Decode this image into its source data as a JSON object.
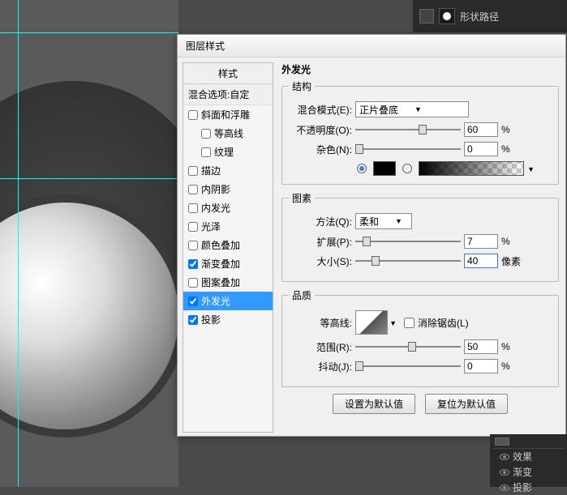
{
  "toolbar": {
    "shape_path_label": "形状路径"
  },
  "dialog": {
    "title": "图层样式",
    "styles_header": "样式",
    "blend_options": "混合选项:自定",
    "items": [
      {
        "label": "斜面和浮雕",
        "checked": false
      },
      {
        "label": "等高线",
        "checked": false,
        "indent": true
      },
      {
        "label": "纹理",
        "checked": false,
        "indent": true
      },
      {
        "label": "描边",
        "checked": false
      },
      {
        "label": "内阴影",
        "checked": false
      },
      {
        "label": "内发光",
        "checked": false
      },
      {
        "label": "光泽",
        "checked": false
      },
      {
        "label": "颜色叠加",
        "checked": false
      },
      {
        "label": "渐变叠加",
        "checked": true
      },
      {
        "label": "图案叠加",
        "checked": false
      },
      {
        "label": "外发光",
        "checked": true,
        "selected": true
      },
      {
        "label": "投影",
        "checked": true
      }
    ],
    "panel_title": "外发光",
    "structure": {
      "legend": "结构",
      "blend_mode_label": "混合模式(E):",
      "blend_mode_value": "正片叠底",
      "opacity_label": "不透明度(O):",
      "opacity_value": "60",
      "opacity_unit": "%",
      "noise_label": "杂色(N):",
      "noise_value": "0",
      "noise_unit": "%"
    },
    "elements": {
      "legend": "图素",
      "technique_label": "方法(Q):",
      "technique_value": "柔和",
      "spread_label": "扩展(P):",
      "spread_value": "7",
      "spread_unit": "%",
      "size_label": "大小(S):",
      "size_value": "40",
      "size_unit": "像素"
    },
    "quality": {
      "legend": "品质",
      "contour_label": "等高线:",
      "antialias_label": "消除锯齿(L)",
      "range_label": "范围(R):",
      "range_value": "50",
      "range_unit": "%",
      "jitter_label": "抖动(J):",
      "jitter_value": "0",
      "jitter_unit": "%"
    },
    "buttons": {
      "set_default": "设置为默认值",
      "reset_default": "复位为默认值"
    }
  },
  "layers": {
    "fx_label": "效果",
    "grad_label": "渐变",
    "shadow_label": "投影"
  }
}
